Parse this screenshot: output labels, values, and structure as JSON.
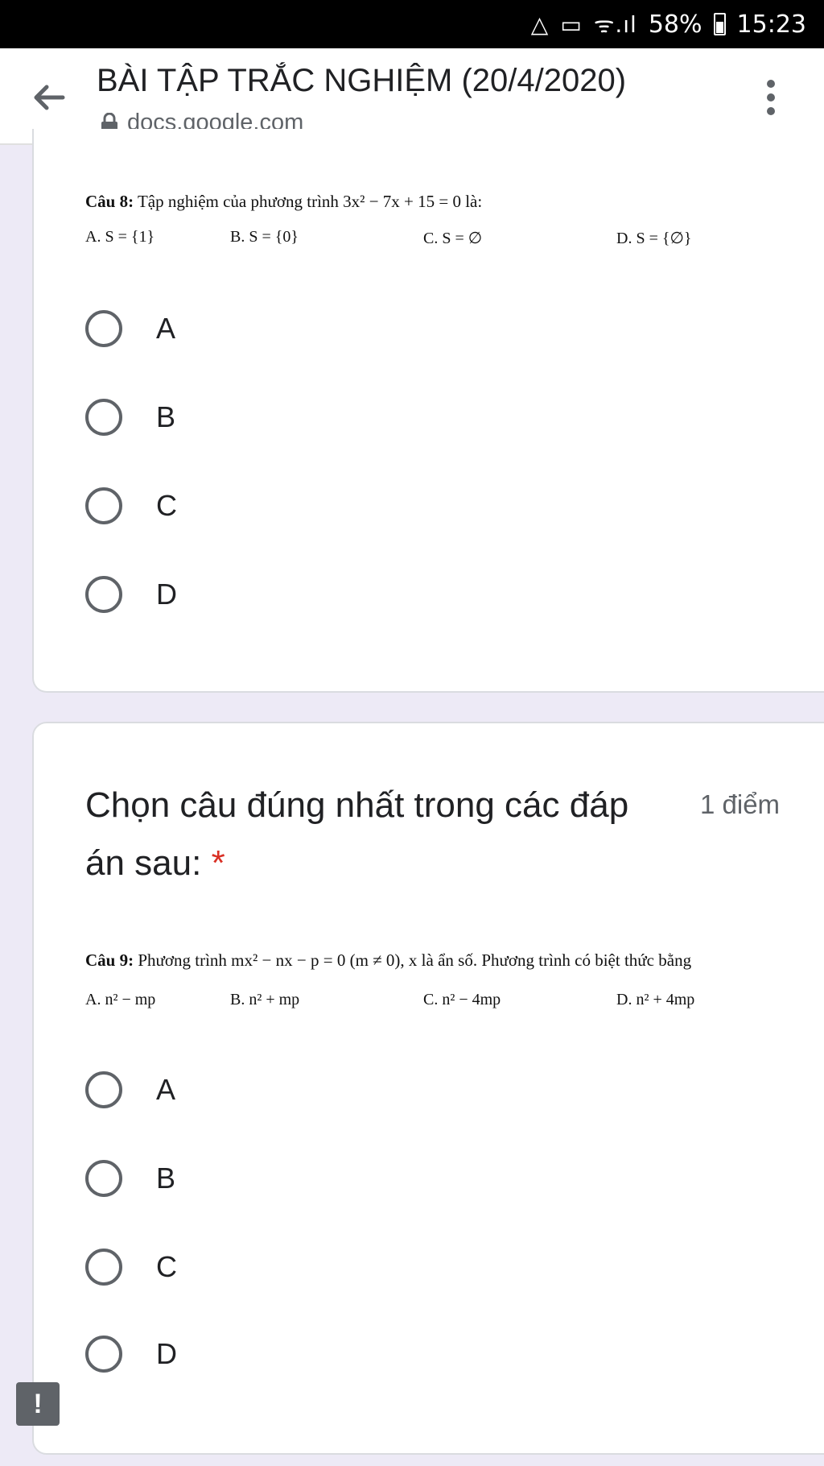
{
  "status_bar": {
    "icons": [
      "drive-icon",
      "cast-icon",
      "wifi-icon",
      "signal-icon",
      "battery-icon"
    ],
    "battery": "58%",
    "time": "15:23"
  },
  "app_bar": {
    "title": "BÀI TẬP TRẮC NGHIỆM (20/4/2020)",
    "url": "docs.google.com"
  },
  "question8": {
    "label": "Câu 8:",
    "text": "Tập nghiệm của phương trình 3x² − 7x + 15 = 0 là:",
    "answers": {
      "a": "A. S = {1}",
      "b": "B. S = {0}",
      "c": "C. S = ∅",
      "d": "D. S = {∅}"
    },
    "choices": [
      "A",
      "B",
      "C",
      "D"
    ]
  },
  "question9": {
    "heading": "Chọn câu đúng nhất trong các đáp án sau:",
    "required_mark": "*",
    "points": "1 điểm",
    "label": "Câu 9:",
    "text": "Phương trình mx² − nx − p = 0 (m ≠ 0), x là ẩn số. Phương trình có biệt thức bằng",
    "answers": {
      "a": "A. n² − mp",
      "b": "B. n² + mp",
      "c": "C. n² − 4mp",
      "d": "D. n² + 4mp"
    },
    "choices": [
      "A",
      "B",
      "C",
      "D"
    ]
  },
  "feedback_icon": "!"
}
